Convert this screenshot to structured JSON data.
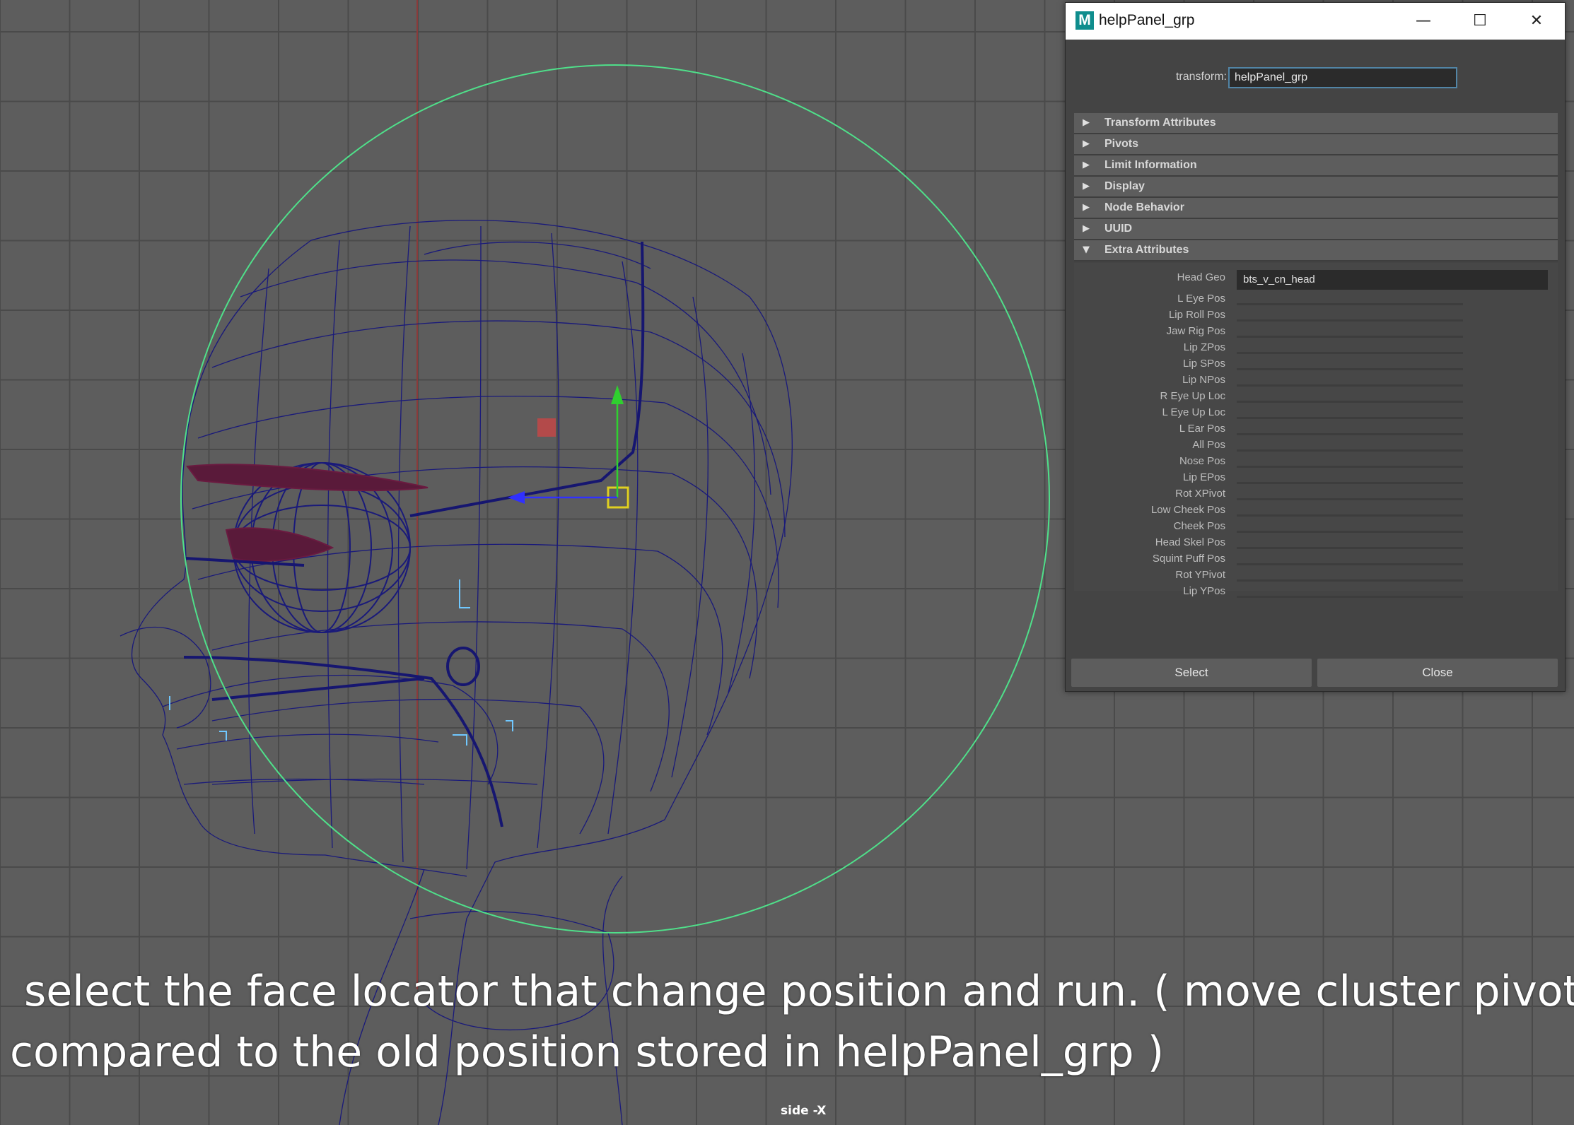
{
  "viewport": {
    "view_name": "side -X",
    "subtitle_line1": "select the face locator that change position and run. ( move cluster pivot",
    "subtitle_line2": "compared to the old position stored in helpPanel_grp )"
  },
  "dialog": {
    "title": "helpPanel_grp",
    "app_icon": "M",
    "transform_label": "transform:",
    "transform_value": "helpPanel_grp",
    "sections": [
      {
        "label": "Transform Attributes",
        "expanded": false
      },
      {
        "label": "Pivots",
        "expanded": false
      },
      {
        "label": "Limit Information",
        "expanded": false
      },
      {
        "label": "Display",
        "expanded": false
      },
      {
        "label": "Node Behavior",
        "expanded": false
      },
      {
        "label": "UUID",
        "expanded": false
      },
      {
        "label": "Extra Attributes",
        "expanded": true
      }
    ],
    "head_geo_label": "Head Geo",
    "head_geo_value": "bts_v_cn_head",
    "extra_attributes": [
      "L Eye Pos",
      "Lip Roll Pos",
      "Jaw Rig Pos",
      "Lip ZPos",
      "Lip SPos",
      "Lip NPos",
      "R Eye Up Loc",
      "L Eye Up Loc",
      "L Ear Pos",
      "All Pos",
      "Nose Pos",
      "Lip EPos",
      "Rot XPivot",
      "Low Cheek Pos",
      "Cheek Pos",
      "Head Skel Pos",
      "Squint Puff Pos",
      "Rot YPivot",
      "Lip YPos"
    ],
    "select_label": "Select",
    "close_label": "Close"
  },
  "colors": {
    "viewport_bg": "#5d5d5d",
    "wireframe": "#1a1a7a",
    "control_curve": "#4fe08a",
    "dialog_bg": "#444444"
  }
}
